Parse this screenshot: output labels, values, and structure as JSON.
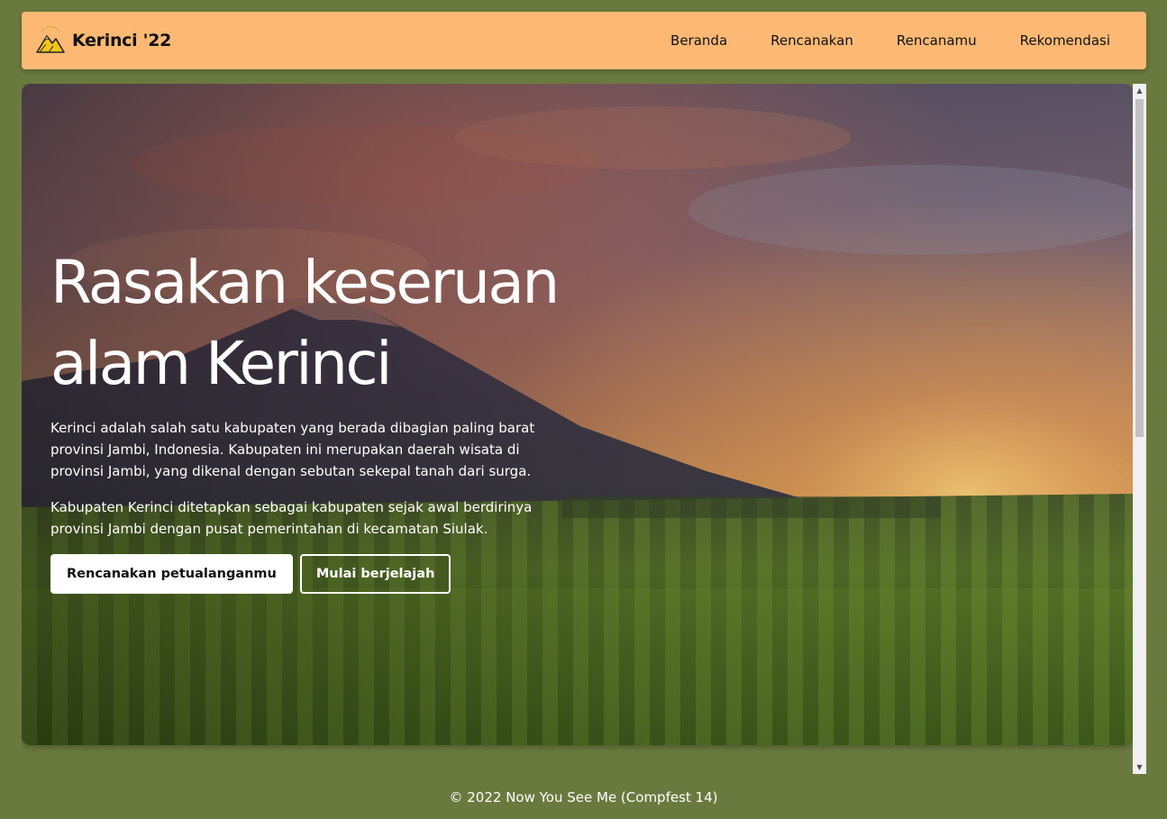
{
  "nav": {
    "brand": "Kerinci '22",
    "logo_icon": "kerinci-mountain-logo",
    "links": [
      "Beranda",
      "Rencanakan",
      "Rencanamu",
      "Rekomendasi"
    ]
  },
  "hero": {
    "title_line1": "Rasakan keseruan",
    "title_line2": "alam Kerinci",
    "paragraph1": "Kerinci adalah salah satu kabupaten yang berada dibagian paling barat provinsi Jambi, Indonesia. Kabupaten ini merupakan daerah wisata di provinsi Jambi, yang dikenal dengan sebutan sekepal tanah dari surga.",
    "paragraph2": "Kabupaten Kerinci ditetapkan sebagai kabupaten sejak awal berdirinya provinsi Jambi dengan pusat pemerintahan di kecamatan Siulak.",
    "primary_button": "Rencanakan petualanganmu",
    "secondary_button": "Mulai berjelajah"
  },
  "scroll": {
    "up_icon": "▲",
    "down_icon": "▼"
  },
  "footer": {
    "text": "© 2022 Now You See Me (Compfest 14)"
  },
  "colors": {
    "page_bg": "#6a7a3f",
    "navbar_bg": "#fdb974",
    "text_dark": "#111111",
    "text_light": "#ffffff"
  }
}
